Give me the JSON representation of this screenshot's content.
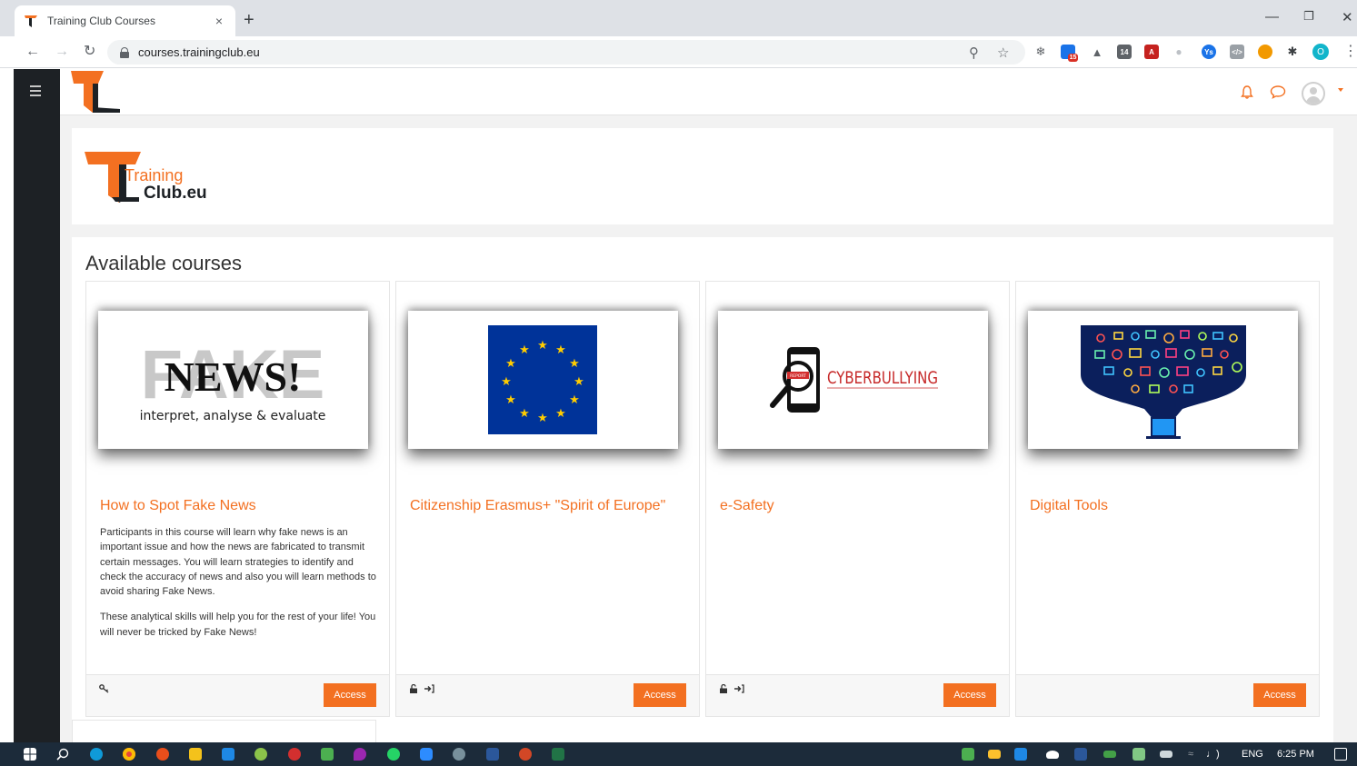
{
  "browser": {
    "tab_title": "Training Club Courses",
    "tab_close": "×",
    "new_tab": "+",
    "url": "courses.trainingclub.eu",
    "calendar_badge": "15",
    "ext_14": "14",
    "profile_initial": "O"
  },
  "site": {
    "logo_line1": "Training",
    "logo_line2": "Club.eu"
  },
  "main": {
    "section_title": "Available courses",
    "courses": [
      {
        "title": "How to Spot Fake News",
        "image_word_bg": "FAKE",
        "image_word": "NEWS!",
        "image_caption": "interpret, analyse & evaluate",
        "desc_p1": "Participants in this course will learn why fake news is an important issue and how the news are fabricated to transmit certain messages. You will learn strategies to identify and check the accuracy of news and also you will learn methods to avoid sharing Fake News.",
        "desc_p2": "These analytical skills will help you for the rest of your life! You will never be tricked by Fake News!",
        "button": "Access"
      },
      {
        "title": "Citizenship Erasmus+ \"Spirit of Europe\"",
        "button": "Access"
      },
      {
        "title": "e-Safety",
        "image_word": "CYBERBULLYING",
        "image_badge": "REPORT",
        "button": "Access"
      },
      {
        "title": "Digital Tools",
        "button": "Access"
      }
    ]
  },
  "taskbar": {
    "lang": "ENG",
    "time": "6:25 PM"
  },
  "colors": {
    "accent": "#f37021",
    "eu_blue": "#003399",
    "eu_gold": "#ffcc00",
    "drawer": "#1d2125"
  }
}
